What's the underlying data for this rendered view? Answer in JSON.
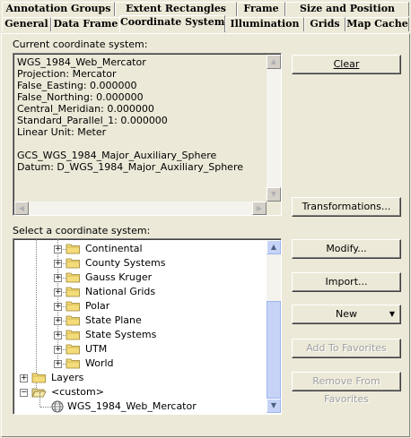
{
  "tabs": {
    "row1": [
      "Annotation Groups",
      "Extent Rectangles",
      "Frame",
      "Size and Position"
    ],
    "row2": [
      "General",
      "Data Frame",
      "Coordinate System",
      "Illumination",
      "Grids",
      "Map Cache"
    ],
    "active": "Coordinate System"
  },
  "current_cs": {
    "label": "Current coordinate system:",
    "lines": [
      "WGS_1984_Web_Mercator",
      "Projection: Mercator",
      "False_Easting: 0.000000",
      "False_Northing: 0.000000",
      "Central_Meridian: 0.000000",
      "Standard_Parallel_1: 0.000000",
      "Linear Unit: Meter",
      "",
      "GCS_WGS_1984_Major_Auxiliary_Sphere",
      "Datum: D_WGS_1984_Major_Auxiliary_Sphere"
    ]
  },
  "select": {
    "label": "Select a coordinate system:",
    "folders": [
      "Continental",
      "County Systems",
      "Gauss Kruger",
      "National Grids",
      "Polar",
      "State Plane",
      "State Systems",
      "UTM",
      "World"
    ],
    "layers": "Layers",
    "custom": "<custom>",
    "custom_item": "WGS_1984_Web_Mercator"
  },
  "buttons": {
    "clear": "Clear",
    "transformations": "Transformations...",
    "modify": "Modify...",
    "import": "Import...",
    "new": "New",
    "add_fav": "Add To Favorites",
    "remove_fav": "Remove From Favorites"
  }
}
